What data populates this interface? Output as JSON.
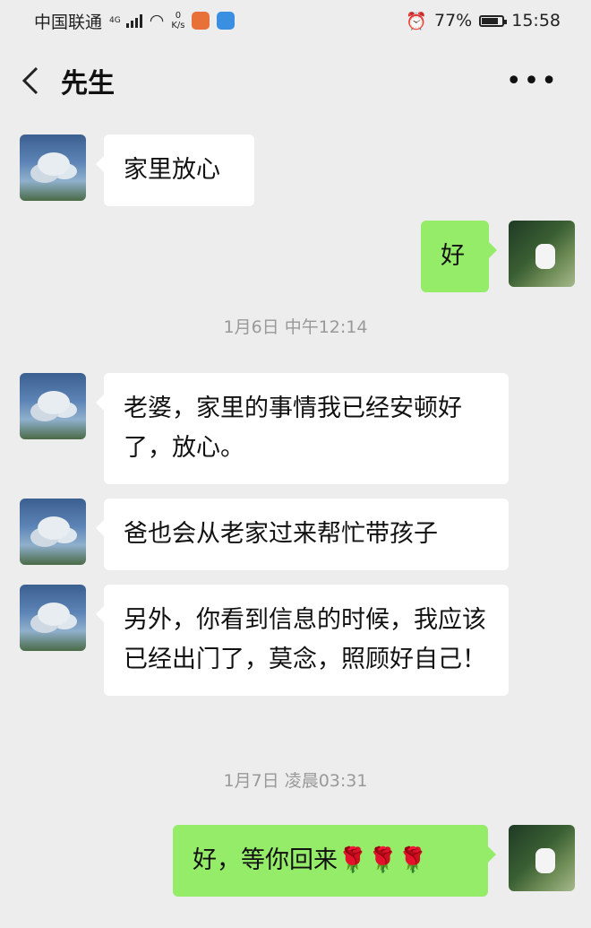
{
  "status_bar": {
    "carrier": "中国联通",
    "net_tag": "4G",
    "speed_value": "0",
    "speed_unit": "K/s",
    "battery": "77%",
    "time": "15:58"
  },
  "header": {
    "title": "先生"
  },
  "messages": [
    {
      "from": "them",
      "text": "家里放心"
    },
    {
      "from": "me",
      "text": "好"
    },
    {
      "from": "them",
      "text": "老婆，家里的事情我已经安顿好了，放心。"
    },
    {
      "from": "them",
      "text": "爸也会从老家过来帮忙带孩子"
    },
    {
      "from": "them",
      "text": "另外，你看到信息的时候，我应该已经出门了，莫念，照顾好自己！"
    },
    {
      "from": "me",
      "text": "好，等你回来🌹🌹🌹"
    }
  ],
  "timestamps": [
    "1月6日 中午12:14",
    "1月7日 凌晨03:31"
  ],
  "colors": {
    "background": "#ededed",
    "incoming_bubble": "#ffffff",
    "outgoing_bubble": "#95ec69",
    "timestamp_text": "#999999"
  }
}
